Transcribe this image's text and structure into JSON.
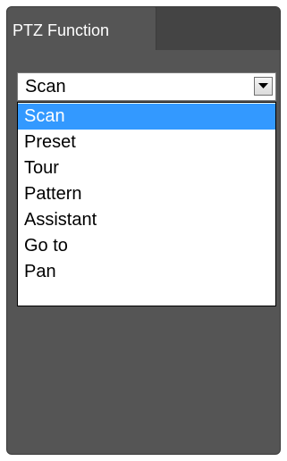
{
  "tab": {
    "label": "PTZ Function"
  },
  "select": {
    "current_value": "Scan",
    "arrow_icon": "triangle-down-icon"
  },
  "dropdown": {
    "options": [
      {
        "label": "Scan",
        "selected": true
      },
      {
        "label": "Preset",
        "selected": false
      },
      {
        "label": "Tour",
        "selected": false
      },
      {
        "label": "Pattern",
        "selected": false
      },
      {
        "label": "Assistant",
        "selected": false
      },
      {
        "label": "Go to",
        "selected": false
      },
      {
        "label": "Pan",
        "selected": false
      }
    ]
  },
  "colors": {
    "panel_bg": "#555555",
    "tab_strip_bg": "#444444",
    "highlight": "#3399ff",
    "text_light": "#ffffff"
  }
}
